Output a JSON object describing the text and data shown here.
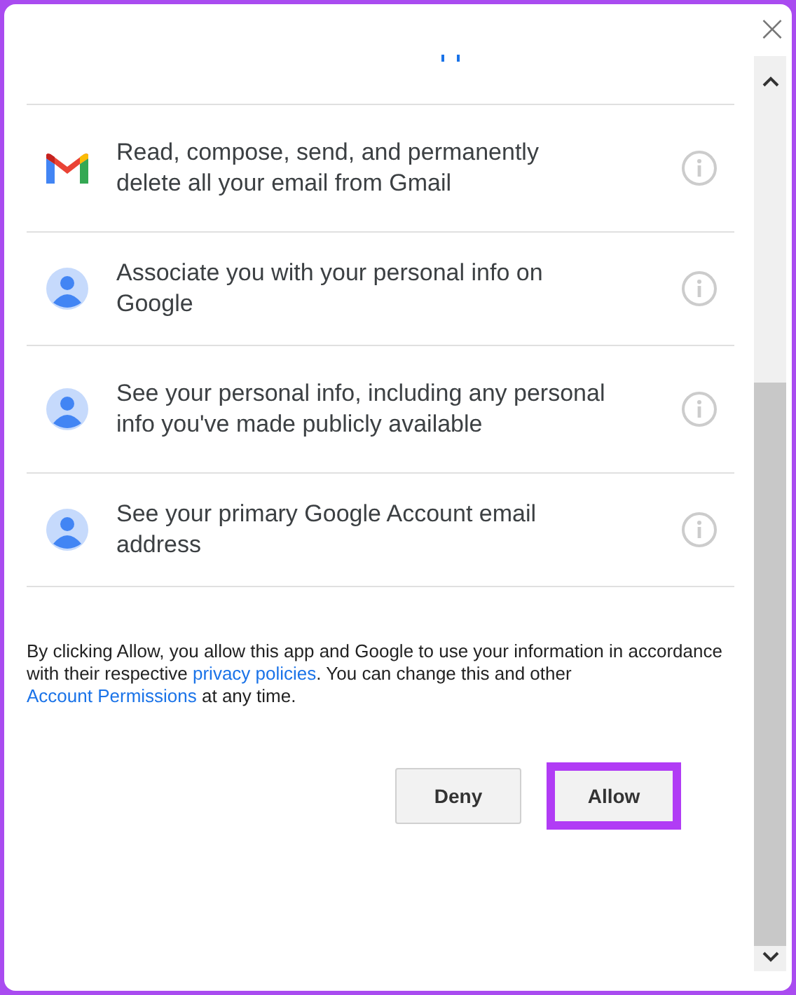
{
  "close_button": {
    "label": "×"
  },
  "permissions": [
    {
      "kind": "gmail",
      "text": "Read, compose, send, and permanently delete all your email from Gmail"
    },
    {
      "kind": "account",
      "text": "Associate you with your personal info on Google"
    },
    {
      "kind": "account",
      "text": "See your personal info, including any personal info you've made publicly available"
    },
    {
      "kind": "account",
      "text": "See your primary Google Account email address"
    }
  ],
  "disclaimer": {
    "before": "By clicking Allow, you allow this app and Google to use your information in accordance with their respective ",
    "link_1": "privacy policies",
    "middle": ". You can change this and other ",
    "link_2": "Account Permissions",
    "after": " at any time."
  },
  "buttons": [
    {
      "label": "Deny",
      "highlighted": false
    },
    {
      "label": "Allow",
      "highlighted": true
    }
  ]
}
